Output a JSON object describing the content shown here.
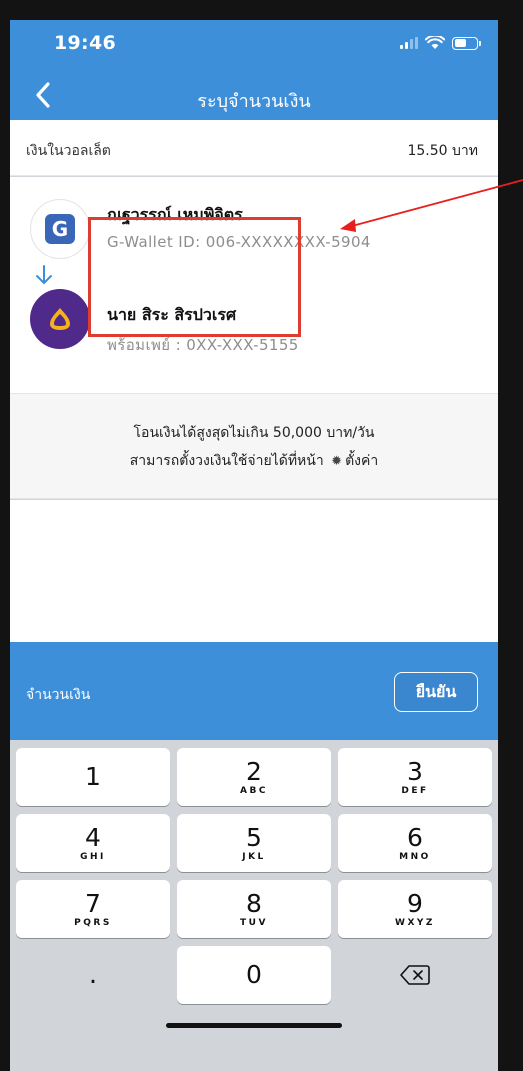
{
  "status_bar": {
    "time": "19:46"
  },
  "header": {
    "title": "ระบุจำนวนเงิน"
  },
  "wallet": {
    "label": "เงินในวอลเล็ต",
    "balance": "15.50 บาท"
  },
  "transfer": {
    "from": {
      "name": "ณฐวรรณ์ เหมพิจิตร",
      "account": "G-Wallet ID: 006-XXXXXXXX-5904",
      "logo_letter": "G"
    },
    "to": {
      "name": "นาย สิระ สิรปวเรศ",
      "account": "พร้อมเพย์ : 0XX-XXX-5155"
    }
  },
  "limit": {
    "line1": "โอนเงินได้สูงสุดไม่เกิน 50,000 บาท/วัน",
    "line2_prefix": "สามารถตั้งวงเงินใช้จ่ายได้ที่หน้า",
    "settings_label": "ตั้งค่า"
  },
  "amount": {
    "label": "จำนวนเงิน",
    "confirm_label": "ยืนยัน"
  },
  "keypad": {
    "keys": [
      {
        "digit": "1",
        "letters": ""
      },
      {
        "digit": "2",
        "letters": "ABC"
      },
      {
        "digit": "3",
        "letters": "DEF"
      },
      {
        "digit": "4",
        "letters": "GHI"
      },
      {
        "digit": "5",
        "letters": "JKL"
      },
      {
        "digit": "6",
        "letters": "MNO"
      },
      {
        "digit": "7",
        "letters": "PQRS"
      },
      {
        "digit": "8",
        "letters": "TUV"
      },
      {
        "digit": "9",
        "letters": "WXYZ"
      },
      {
        "digit": "0",
        "letters": ""
      }
    ],
    "decimal": "."
  },
  "icons": {
    "back": "chevron-left-icon",
    "gwallet": "g-wallet-logo-icon",
    "arrow": "arrow-down-icon",
    "scb": "scb-bank-logo-icon",
    "settings": "gear-icon",
    "delete": "backspace-icon"
  },
  "colors": {
    "primary": "#3d8fd9",
    "annotation": "#dc3d30",
    "scb": "#4f2a8a",
    "gwallet": "#3a66b8"
  }
}
